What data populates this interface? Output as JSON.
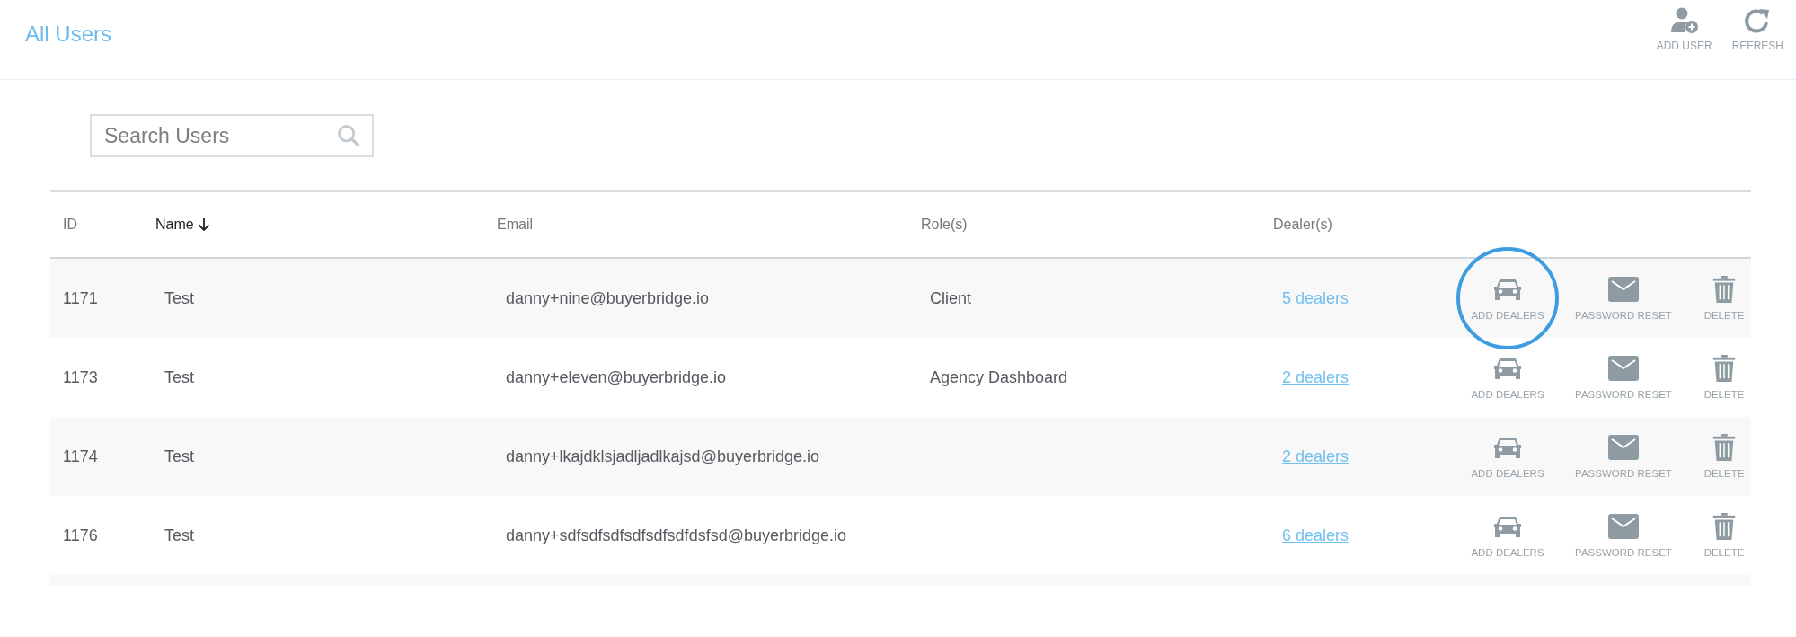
{
  "header": {
    "title": "All Users",
    "actions": [
      {
        "kind": "add-user",
        "label": "ADD USER"
      },
      {
        "kind": "refresh",
        "label": "REFRESH"
      }
    ]
  },
  "search": {
    "placeholder": "Search Users"
  },
  "table": {
    "columns": [
      {
        "label": "ID",
        "sorted": false
      },
      {
        "label": "Name",
        "sorted": true
      },
      {
        "label": "Email",
        "sorted": false
      },
      {
        "label": "Role(s)",
        "sorted": false
      },
      {
        "label": "Dealer(s)",
        "sorted": false
      }
    ],
    "rows": [
      {
        "id": "1171",
        "name": "Test",
        "email": "danny+nine@buyerbridge.io",
        "role": "Client",
        "dealers": "5 dealers",
        "actions": [
          {
            "kind": "car",
            "label": "ADD DEALERS",
            "highlighted": true
          },
          {
            "kind": "mail",
            "label": "PASSWORD RESET",
            "highlighted": false
          },
          {
            "kind": "trash",
            "label": "DELETE",
            "highlighted": false
          }
        ]
      },
      {
        "id": "1173",
        "name": "Test",
        "email": "danny+eleven@buyerbridge.io",
        "role": "Agency Dashboard",
        "dealers": "2 dealers",
        "actions": [
          {
            "kind": "car",
            "label": "ADD DEALERS",
            "highlighted": false
          },
          {
            "kind": "mail",
            "label": "PASSWORD RESET",
            "highlighted": false
          },
          {
            "kind": "trash",
            "label": "DELETE",
            "highlighted": false
          }
        ]
      },
      {
        "id": "1174",
        "name": "Test",
        "email": "danny+lkajdklsjadljadlkajsd@buyerbridge.io",
        "dealers": "2 dealers",
        "actions": [
          {
            "kind": "car",
            "label": "ADD DEALERS",
            "highlighted": false
          },
          {
            "kind": "mail",
            "label": "PASSWORD RESET",
            "highlighted": false
          },
          {
            "kind": "trash",
            "label": "DELETE",
            "highlighted": false
          }
        ]
      },
      {
        "id": "1176",
        "name": "Test",
        "email": "danny+sdfsdfsdfsdfsdfsdfdsfsd@buyerbridge.io",
        "dealers": "6 dealers",
        "actions": [
          {
            "kind": "car",
            "label": "ADD DEALERS",
            "highlighted": false
          },
          {
            "kind": "mail",
            "label": "PASSWORD RESET",
            "highlighted": false
          },
          {
            "kind": "trash",
            "label": "DELETE",
            "highlighted": false
          }
        ]
      }
    ]
  }
}
